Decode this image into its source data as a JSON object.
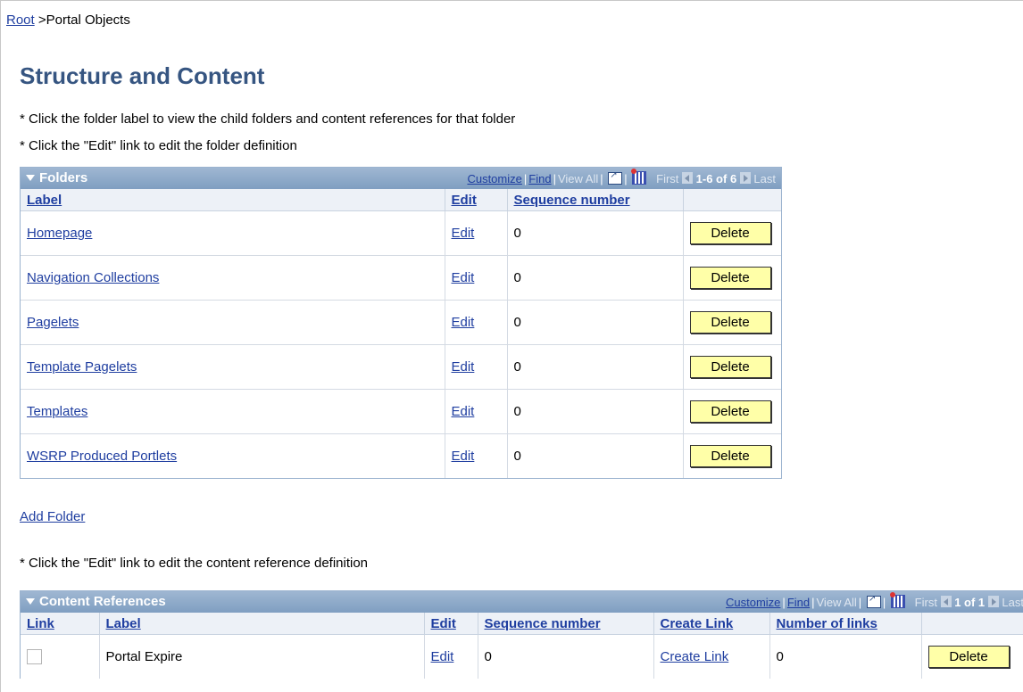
{
  "breadcrumb": {
    "root": "Root",
    "separator": ">",
    "current": "Portal Objects"
  },
  "page_title": "Structure and Content",
  "instructions": {
    "folder_label": "* Click the folder label to view the child folders and content references for that folder",
    "folder_edit": "* Click the \"Edit\" link to edit the folder definition",
    "content_edit": "* Click the \"Edit\" link to edit the content reference definition"
  },
  "folders_grid": {
    "title": "Folders",
    "nav": {
      "customize": "Customize",
      "find": "Find",
      "view_all": "View All",
      "first": "First",
      "range": "1-6 of 6",
      "last": "Last"
    },
    "columns": [
      "Label",
      "Edit",
      "Sequence number"
    ],
    "rows": [
      {
        "label": "Homepage",
        "edit": "Edit",
        "seq": "0",
        "delete": "Delete"
      },
      {
        "label": "Navigation Collections",
        "edit": "Edit",
        "seq": "0",
        "delete": "Delete"
      },
      {
        "label": "Pagelets",
        "edit": "Edit",
        "seq": "0",
        "delete": "Delete"
      },
      {
        "label": "Template Pagelets",
        "edit": "Edit",
        "seq": "0",
        "delete": "Delete"
      },
      {
        "label": "Templates",
        "edit": "Edit",
        "seq": "0",
        "delete": "Delete"
      },
      {
        "label": "WSRP Produced Portlets",
        "edit": "Edit",
        "seq": "0",
        "delete": "Delete"
      }
    ]
  },
  "add_folder": "Add Folder",
  "content_grid": {
    "title": "Content References",
    "nav": {
      "customize": "Customize",
      "find": "Find",
      "view_all": "View All",
      "first": "First",
      "range": "1 of 1",
      "last": "Last"
    },
    "columns": [
      "Link",
      "Label",
      "Edit",
      "Sequence number",
      "Create Link",
      "Number of links"
    ],
    "rows": [
      {
        "link_checked": false,
        "label": "Portal Expire",
        "edit": "Edit",
        "seq": "0",
        "create_link": "Create Link",
        "num_links": "0",
        "delete": "Delete"
      }
    ]
  },
  "colors": {
    "title": "#365581",
    "link": "#1f3ea0",
    "grid_header": "#8aa7c8",
    "button": "#ffffa8"
  }
}
